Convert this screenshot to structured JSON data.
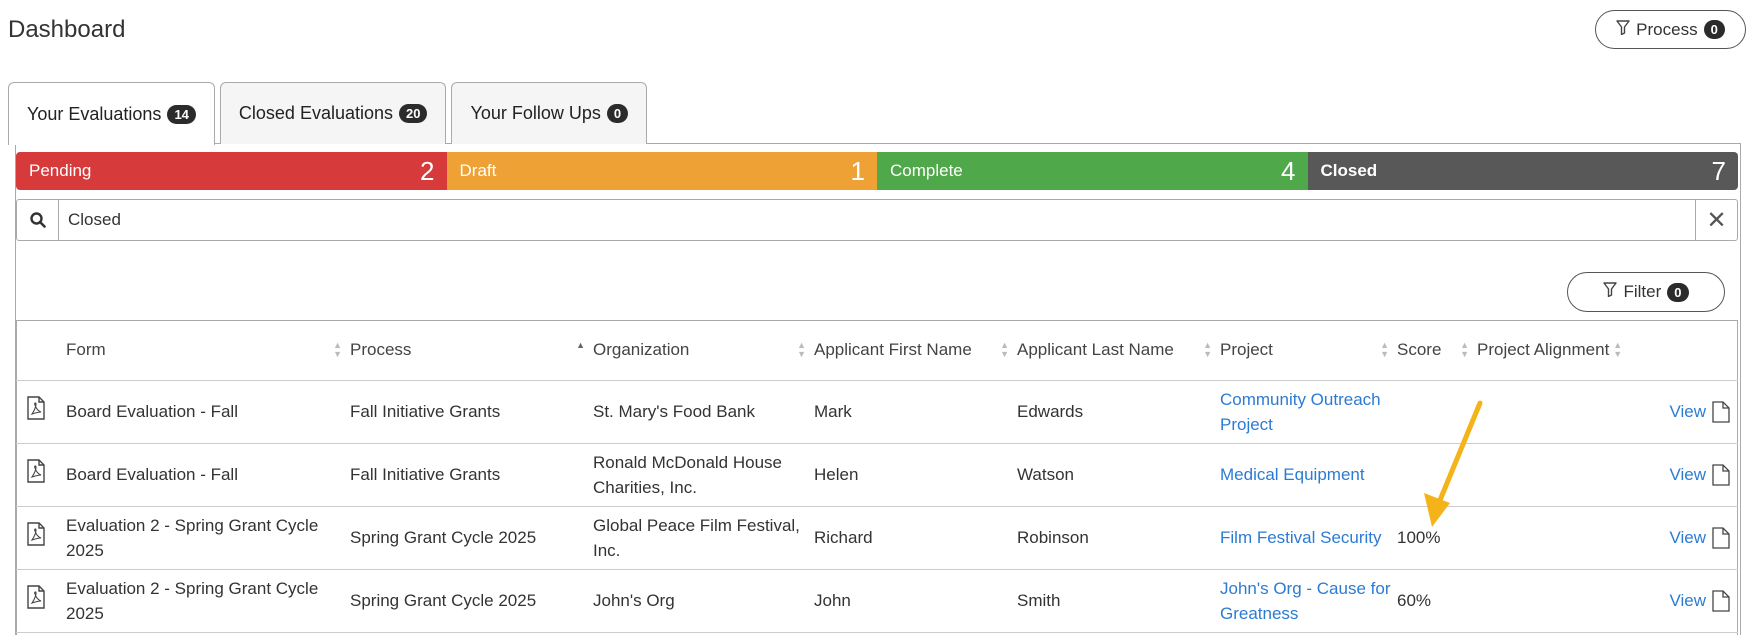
{
  "header": {
    "title": "Dashboard",
    "process_label": "Process",
    "process_count": "0"
  },
  "tabs": [
    {
      "label": "Your Evaluations",
      "count": "14",
      "active": true
    },
    {
      "label": "Closed Evaluations",
      "count": "20",
      "active": false
    },
    {
      "label": "Your Follow Ups",
      "count": "0",
      "active": false
    }
  ],
  "status": [
    {
      "label": "Pending",
      "count": "2",
      "color": "#d63a3a"
    },
    {
      "label": "Draft",
      "count": "1",
      "color": "#eea236"
    },
    {
      "label": "Complete",
      "count": "4",
      "color": "#4fa84a"
    },
    {
      "label": "Closed",
      "count": "7",
      "color": "#585858"
    }
  ],
  "search": {
    "value": "Closed",
    "placeholder": ""
  },
  "filter": {
    "label": "Filter",
    "count": "0"
  },
  "table": {
    "columns": [
      "Form",
      "Process",
      "Organization",
      "Applicant First Name",
      "Applicant Last Name",
      "Project",
      "Score",
      "Project Alignment"
    ],
    "view_label": "View",
    "rows": [
      {
        "form": "Board Evaluation - Fall",
        "process": "Fall Initiative Grants",
        "organization": "St. Mary's Food Bank",
        "first": "Mark",
        "last": "Edwards",
        "project": "Community Outreach Project",
        "score": "",
        "alignment": ""
      },
      {
        "form": "Board Evaluation - Fall",
        "process": "Fall Initiative Grants",
        "organization": "Ronald McDonald House Charities, Inc.",
        "first": "Helen",
        "last": "Watson",
        "project": "Medical Equipment",
        "score": "",
        "alignment": ""
      },
      {
        "form": "Evaluation 2 - Spring Grant Cycle 2025",
        "process": "Spring Grant Cycle 2025",
        "organization": "Global Peace Film Festival, Inc.",
        "first": "Richard",
        "last": "Robinson",
        "project": "Film Festival Security",
        "score": "100%",
        "alignment": ""
      },
      {
        "form": "Evaluation 2 - Spring Grant Cycle 2025",
        "process": "Spring Grant Cycle 2025",
        "organization": "John's Org",
        "first": "John",
        "last": "Smith",
        "project": "John's Org - Cause for Greatness",
        "score": "60%",
        "alignment": ""
      }
    ]
  },
  "annotation": {
    "arrow_color": "#f5b31a"
  }
}
